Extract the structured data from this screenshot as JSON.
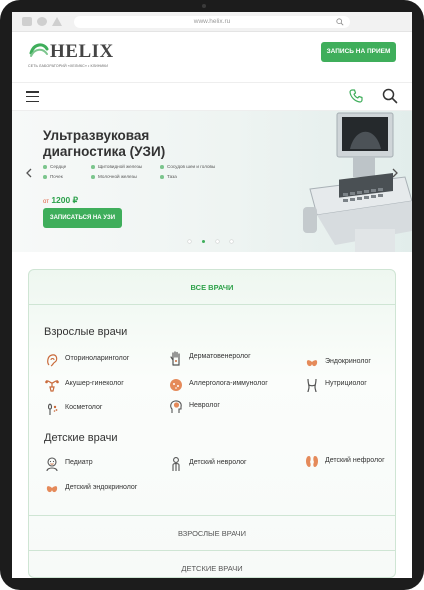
{
  "browser": {
    "url": "www.helix.ru"
  },
  "header": {
    "logo_text": "HELIX",
    "logo_sub": "СЕТЬ ЛАБОРАТОРИЙ «ХЕЛИКС» • КЛИНИКИ",
    "cta_label": "ЗАПИСЬ НА ПРИЕМ"
  },
  "banner": {
    "title": "Ультразвуковая диагностика (УЗИ)",
    "items": [
      "Сердце",
      "Щитовидной железы",
      "Сосудов шеи и головы",
      "Почек",
      "Молочной железы",
      "Таза"
    ],
    "price_from": "от",
    "price": "1200 ₽",
    "button_label": "ЗАПИСАТЬСЯ НА УЗИ",
    "active_slide": 2,
    "slide_count": 4
  },
  "doctors": {
    "all_label": "ВСЕ ВРАЧИ",
    "adult_title": "Взрослые врачи",
    "adult": [
      {
        "label": "Оториноларинголог",
        "icon": "ear-icon"
      },
      {
        "label": "Дерматовенеролог",
        "icon": "hand-icon"
      },
      {
        "label": "Эндокринолог",
        "icon": "thyroid-icon"
      },
      {
        "label": "Акушер-гинеколог",
        "icon": "uterus-icon"
      },
      {
        "label": "Аллерголога-иммунолог",
        "icon": "allergy-icon"
      },
      {
        "label": "Нутрициолог",
        "icon": "body-icon"
      },
      {
        "label": "Косметолог",
        "icon": "cosmetology-icon"
      },
      {
        "label": "Невролог",
        "icon": "brain-head-icon"
      }
    ],
    "kids_title": "Детские врачи",
    "kids": [
      {
        "label": "Педиатр",
        "icon": "baby-icon"
      },
      {
        "label": "Детский невролог",
        "icon": "child-icon"
      },
      {
        "label": "Детский нефролог",
        "icon": "kidney-icon"
      },
      {
        "label": "Детский эндокринолог",
        "icon": "thyroid-icon"
      }
    ],
    "tab_adult": "ВЗРОСЛЫЕ ВРАЧИ",
    "tab_kids": "ДЕТСКИЕ ВРАЧИ"
  },
  "colors": {
    "accent": "#3fae5b",
    "price": "#2ca14b",
    "panel_border": "#cfe5d4"
  }
}
